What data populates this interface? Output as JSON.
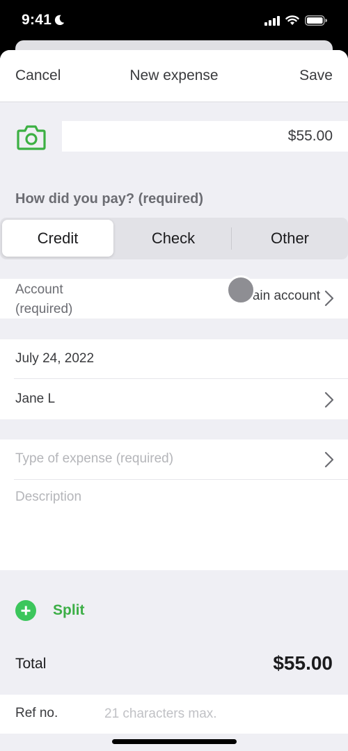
{
  "status_bar": {
    "time": "9:41",
    "icons": [
      "moon-icon",
      "signal-icon",
      "wifi-icon",
      "battery-icon"
    ]
  },
  "nav": {
    "cancel_label": "Cancel",
    "title": "New expense",
    "save_label": "Save"
  },
  "amount": {
    "value": "$55.00",
    "camera_icon": "camera-icon"
  },
  "payment": {
    "label": "How did you pay? (required)",
    "options": [
      {
        "label": "Credit",
        "selected": true
      },
      {
        "label": "Check",
        "selected": false
      },
      {
        "label": "Other",
        "selected": false
      }
    ]
  },
  "account": {
    "label_line1": "Account",
    "label_line2": "(required)",
    "value": "Main account"
  },
  "details": {
    "date": "July 24, 2022",
    "payee": "Jane L"
  },
  "expense": {
    "type_placeholder": "Type of expense (required)",
    "description_placeholder": "Description"
  },
  "split": {
    "label": "Split"
  },
  "total": {
    "label": "Total",
    "value": "$55.00"
  },
  "ref": {
    "label": "Ref no.",
    "placeholder": "21 characters max."
  },
  "colors": {
    "accent_green": "#3cae46",
    "plus_green": "#3cc65c",
    "background": "#efeff4",
    "text": "#393a3d"
  }
}
